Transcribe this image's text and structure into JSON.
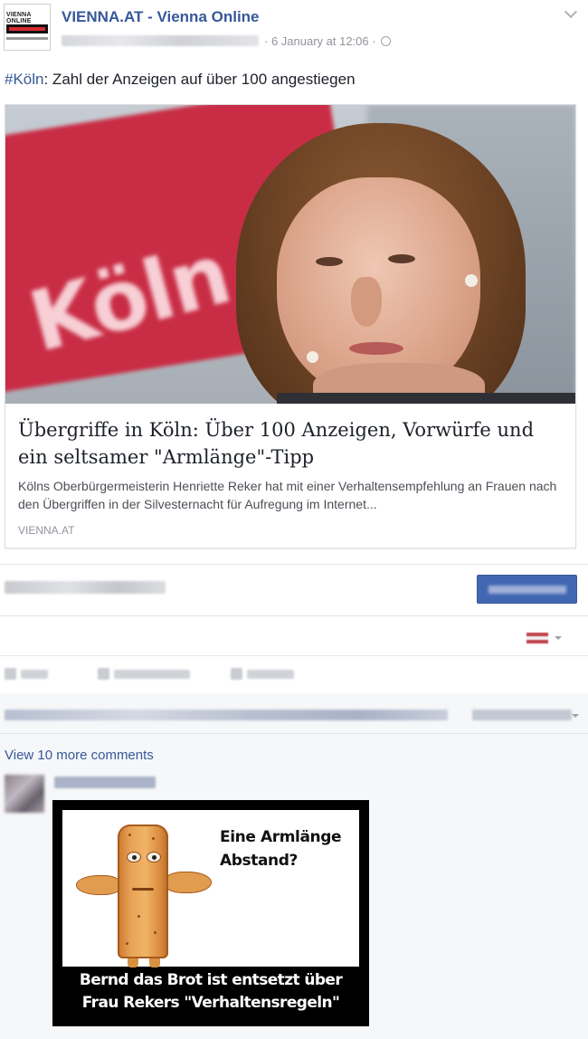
{
  "post": {
    "page_name": "VIENNA.AT - Vienna Online",
    "logo_text": "VIENNA ONLINE",
    "date": "· 6 January at 12:06 ·",
    "text_hashtag": "#Köln",
    "text_body": ": Zahl der Anzeigen auf über 100 angestiegen"
  },
  "link_preview": {
    "title": "Übergriffe in Köln: Über 100 Anzeigen, Vorwürfe und ein seltsamer \"Armlänge\"-Tipp",
    "description": "Kölns Oberbürgermeisterin Henriette Reker hat mit einer Verhaltensempfehlung an Frauen nach den Übergriffen in der Silvesternacht für Aufregung im Internet...",
    "domain": "VIENNA.AT",
    "photo_banner_text": "Köln"
  },
  "comments": {
    "view_more": "View 10 more comments"
  },
  "meme": {
    "line1": "Eine Armlänge",
    "line2": "Abstand?",
    "caption1": "Bernd das Brot ist entsetzt über",
    "caption2": "Frau Rekers \"Verhaltensregeln\""
  },
  "colors": {
    "link_blue": "#365899",
    "boost_button": "#4267b2",
    "comment_bg": "#f6f7f9"
  }
}
